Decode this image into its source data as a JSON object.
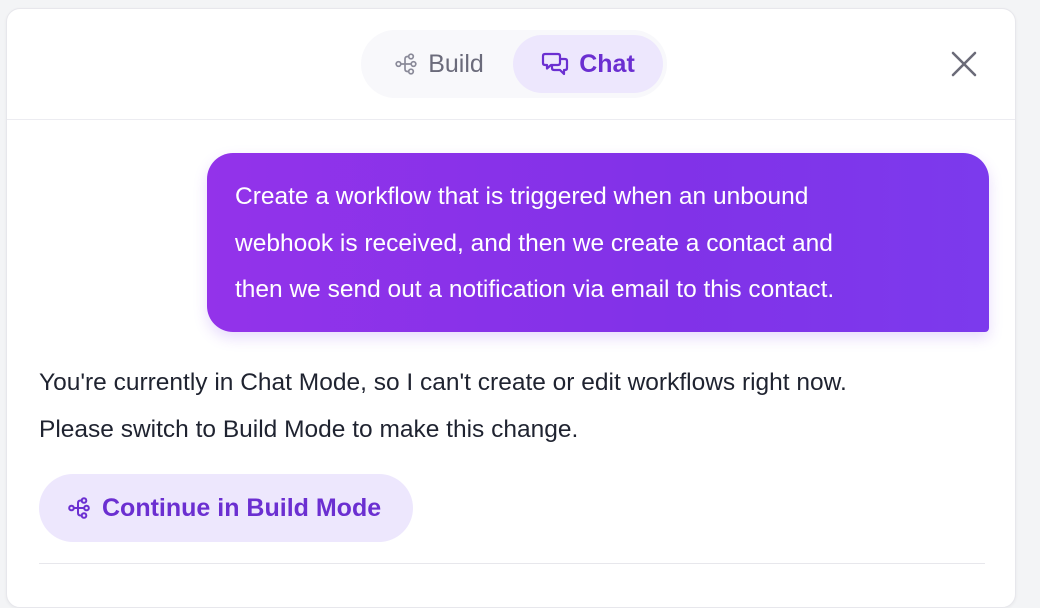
{
  "header": {
    "tabs": [
      {
        "label": "Build",
        "icon": "workflow-icon",
        "active": false
      },
      {
        "label": "Chat",
        "icon": "chat-bubbles-icon",
        "active": true
      }
    ],
    "close_icon": "close-icon"
  },
  "messages": {
    "user": {
      "lines": [
        "Create a workflow that is triggered when an unbound",
        "webhook is received, and then we create a contact and",
        "then we send out a notification via email to this contact."
      ]
    },
    "assistant": {
      "lines": [
        "You're currently in Chat Mode, so I can't create or edit workflows right now.",
        "Please switch to Build Mode to make this change."
      ],
      "action_label": "Continue in Build Mode",
      "action_icon": "workflow-icon"
    }
  },
  "colors": {
    "accent": "#6b2fd1",
    "accent_soft": "#ede7fd",
    "bubble_start": "#9333ea",
    "bubble_end": "#7c3aed",
    "text": "#1f2330",
    "muted": "#6b6b7b"
  }
}
